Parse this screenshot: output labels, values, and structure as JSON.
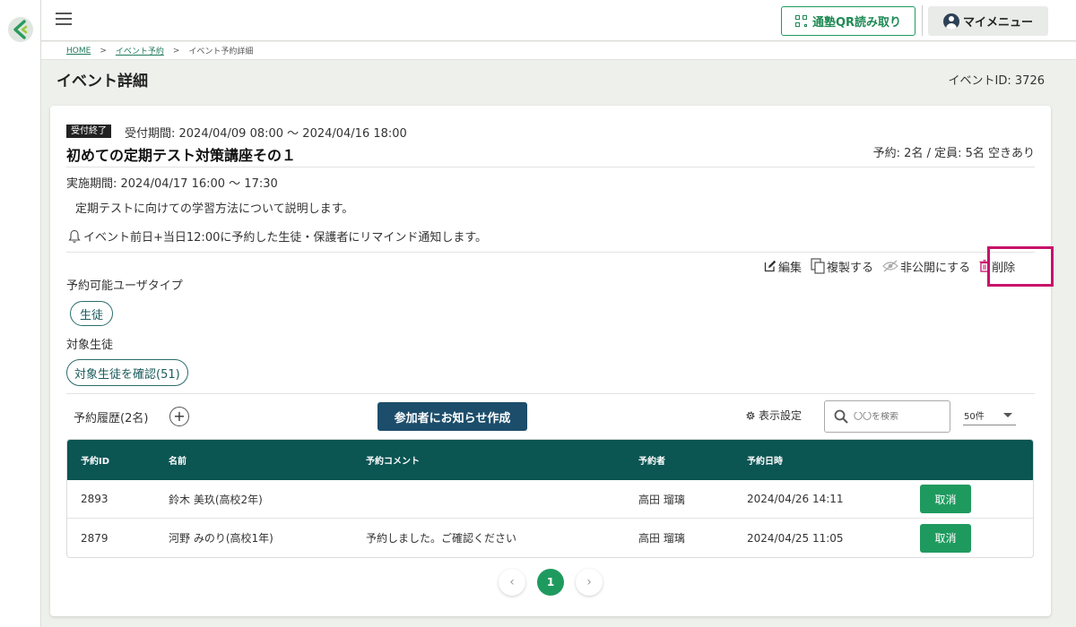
{
  "header": {
    "qr_button_label": "通塾QR読み取り",
    "menu_button_label": "マイメニュー"
  },
  "breadcrumb": {
    "home": "HOME",
    "sep": ">",
    "events": "イベント予約",
    "current": "イベント予約詳細"
  },
  "page": {
    "title": "イベント詳細",
    "event_id_text": "イベントID: 3726"
  },
  "event": {
    "status_badge": "受付終了",
    "reception_period": "受付期間: 2024/04/09 08:00 〜 2024/04/16 18:00",
    "name": "初めての定期テスト対策講座その１",
    "capacity_text": "予約: 2名 / 定員: 5名 空きあり",
    "held_period": "実施期間: 2024/04/17 16:00 〜 17:30",
    "description": "定期テストに向けての学習方法について説明します。",
    "reminder": "イベント前日+当日12:00に予約した生徒・保護者にリマインド通知します。"
  },
  "actions": {
    "edit": "編集",
    "duplicate": "複製する",
    "hide": "非公開にする",
    "delete": "削除"
  },
  "targets": {
    "user_type_label": "予約可能ユーザタイプ",
    "user_type_chip": "生徒",
    "target_students_label": "対象生徒",
    "confirm_chip": "対象生徒を確認(51)"
  },
  "history": {
    "label": "予約履歴(2名)",
    "notify_button": "参加者にお知らせ作成",
    "display_setting": "表示設定",
    "search_placeholder": "〇〇を検索",
    "per_page": "50件"
  },
  "table": {
    "columns": [
      "予約ID",
      "名前",
      "予約コメント",
      "予約者",
      "予約日時"
    ],
    "rows": [
      {
        "id": "2893",
        "name": "鈴木 美玖(高校2年)",
        "comment": "",
        "booker": "高田 瑠璃",
        "datetime": "2024/04/26 14:11",
        "action": "取消"
      },
      {
        "id": "2879",
        "name": "河野 みのり(高校1年)",
        "comment": "予約しました。ご確認ください",
        "booker": "高田 瑠璃",
        "datetime": "2024/04/25 11:05",
        "action": "取消"
      }
    ]
  },
  "pagination": {
    "current_page": "1",
    "prev_icon": "chevron-left-icon",
    "next_icon": "chevron-right-icon"
  },
  "colors": {
    "accent_green": "#1f9a5f",
    "table_header": "#0b5553",
    "notify_button": "#1c4d6b",
    "highlight_frame": "#c8106a"
  }
}
